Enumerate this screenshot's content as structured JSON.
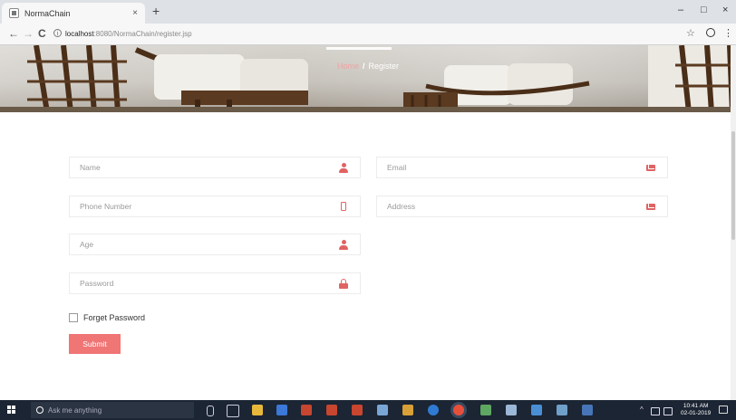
{
  "browser": {
    "tab_title": "NormaChain",
    "tab_close": "×",
    "new_tab": "+",
    "url_host": "localhost",
    "url_path": ":8080/NormaChain/register.jsp",
    "minimize": "–",
    "maximize": "□",
    "close": "×",
    "back": "←",
    "forward": "→",
    "reload": "C",
    "info": "i",
    "star": "☆",
    "menu": "⋮"
  },
  "hero": {
    "breadcrumb_home": "Home",
    "breadcrumb_sep": "/",
    "breadcrumb_current": "Register"
  },
  "form": {
    "name_placeholder": "Name",
    "email_placeholder": "Email",
    "phone_placeholder": "Phone Number",
    "address_placeholder": "Address",
    "age_placeholder": "Age",
    "password_placeholder": "Password",
    "checkbox_label": "Forget Password",
    "submit_label": "Submit"
  },
  "taskbar": {
    "search_placeholder": "Ask me anything",
    "time": "10:41 AM",
    "date": "02-01-2019",
    "tray_chevron": "^",
    "accent": "#f07575"
  }
}
